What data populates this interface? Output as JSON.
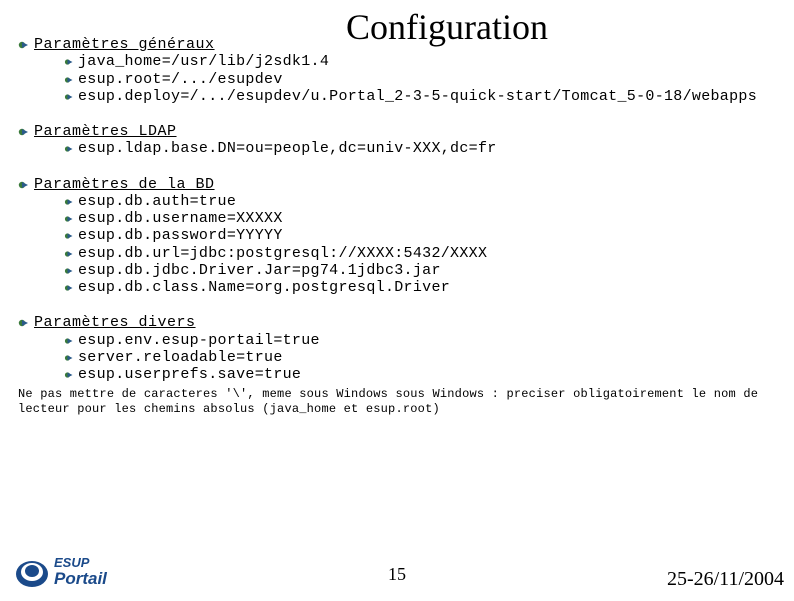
{
  "title": "Configuration",
  "sections": [
    {
      "heading": "Paramètres généraux",
      "items": [
        "java_home=/usr/lib/j2sdk1.4",
        "esup.root=/.../esupdev",
        "esup.deploy=/.../esupdev/u.Portal_2-3-5-quick-start/Tomcat_5-0-18/webapps"
      ]
    },
    {
      "heading": "Paramètres LDAP",
      "items": [
        "esup.ldap.base.DN=ou=people,dc=univ-XXX,dc=fr"
      ]
    },
    {
      "heading": "Paramètres de la BD",
      "items": [
        "esup.db.auth=true",
        "esup.db.username=XXXXX",
        "esup.db.password=YYYYY",
        "esup.db.url=jdbc:postgresql://XXXX:5432/XXXX",
        "esup.db.jdbc.Driver.Jar=pg74.1jdbc3.jar",
        "esup.db.class.Name=org.postgresql.Driver"
      ]
    },
    {
      "heading": "Paramètres divers",
      "items": [
        "esup.env.esup-portail=true",
        "server.reloadable=true",
        "esup.userprefs.save=true"
      ]
    }
  ],
  "footnote": "Ne pas mettre de caracteres '\\', meme sous Windows sous Windows : preciser obligatoirement le nom de lecteur pour les chemins absolus (java_home et esup.root)",
  "logo": {
    "text_top": "ESUP",
    "text_bottom": "Portail"
  },
  "page_number": "15",
  "date": "25-26/11/2004"
}
